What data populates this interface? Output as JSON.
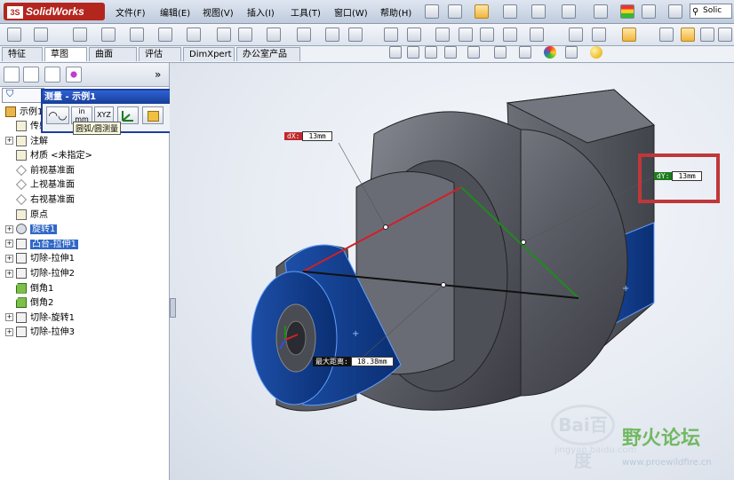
{
  "app": {
    "name": "SolidWorks",
    "brand_color": "#b3261e"
  },
  "menu": [
    "文件(F)",
    "编辑(E)",
    "视图(V)",
    "插入(I)",
    "工具(T)",
    "窗口(W)",
    "帮助(H)"
  ],
  "search_partial": "Solic",
  "tabs": [
    {
      "label": "特征",
      "active": false
    },
    {
      "label": "草图",
      "active": true
    },
    {
      "label": "曲面",
      "active": false
    },
    {
      "label": "评估",
      "active": false
    },
    {
      "label": "DimXpert",
      "active": false
    },
    {
      "label": "办公室产品",
      "active": false
    }
  ],
  "panel": {
    "more": "»"
  },
  "tree": {
    "root": "示例1",
    "items": [
      {
        "label": "传感器",
        "expandable": false,
        "icon": "sensor-icon"
      },
      {
        "label": "注解",
        "expandable": true,
        "icon": "annotation-icon"
      },
      {
        "label": "材质 <未指定>",
        "expandable": false,
        "icon": "material-icon"
      },
      {
        "label": "前视基准面",
        "expandable": false,
        "icon": "plane-icon"
      },
      {
        "label": "上视基准面",
        "expandable": false,
        "icon": "plane-icon"
      },
      {
        "label": "右视基准面",
        "expandable": false,
        "icon": "plane-icon"
      },
      {
        "label": "原点",
        "expandable": false,
        "icon": "origin-icon"
      },
      {
        "label": "旋转1",
        "expandable": true,
        "icon": "revolve-icon",
        "selected": true
      },
      {
        "label": "凸台-拉伸1",
        "expandable": true,
        "icon": "extrude-icon",
        "selected": true
      },
      {
        "label": "切除-拉伸1",
        "expandable": true,
        "icon": "cut-extrude-icon"
      },
      {
        "label": "切除-拉伸2",
        "expandable": true,
        "icon": "cut-extrude-icon"
      },
      {
        "label": "倒角1",
        "expandable": false,
        "icon": "chamfer-icon"
      },
      {
        "label": "倒角2",
        "expandable": false,
        "icon": "chamfer-icon"
      },
      {
        "label": "切除-旋转1",
        "expandable": true,
        "icon": "cut-revolve-icon"
      },
      {
        "label": "切除-拉伸3",
        "expandable": true,
        "icon": "cut-extrude-icon"
      }
    ]
  },
  "measure": {
    "title": "测量 - 示例1",
    "close": "✕",
    "units_button": "in\nmm",
    "xyz_button": "XYZ",
    "expand": "⌄",
    "tooltip": "圆弧/圆测量"
  },
  "dimensions": {
    "dx": {
      "key": "dX:",
      "value": "13mm"
    },
    "dy": {
      "key": "dY:",
      "value": "13mm"
    },
    "max": {
      "key": "最大距离:",
      "value": "18.38mm"
    }
  },
  "watermark": {
    "line1": "Bai百度",
    "line2": "野火论坛",
    "line3": "jingyan.baidu.com",
    "line4": "www.proewildfire.cn"
  },
  "colors": {
    "selection_blue": "#3168c6",
    "highlight_red": "#c0373a",
    "face_blue": "#0d3a8a",
    "part_grey": "#5b5d66"
  }
}
